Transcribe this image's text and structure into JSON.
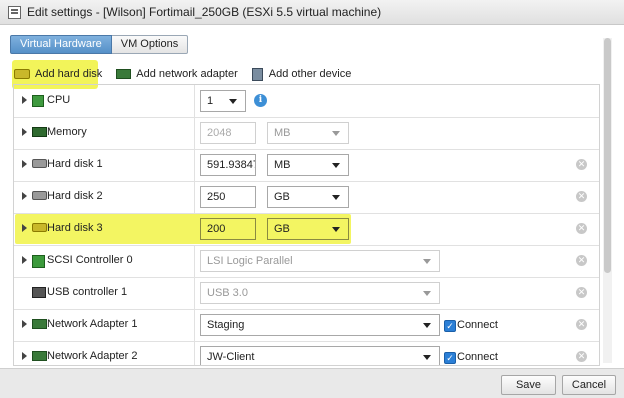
{
  "window": {
    "title": "Edit settings - [Wilson] Fortimail_250GB (ESXi 5.5 virtual machine)"
  },
  "tabs": [
    {
      "label": "Virtual Hardware"
    },
    {
      "label": "VM Options"
    }
  ],
  "toolbar": {
    "add_hard_disk": "Add hard disk",
    "add_network_adapter": "Add network adapter",
    "add_other_device": "Add other device"
  },
  "rows": {
    "cpu": {
      "label": "CPU",
      "value": "1"
    },
    "memory": {
      "label": "Memory",
      "value": "2048",
      "unit": "MB"
    },
    "hd1": {
      "label": "Hard disk 1",
      "value": "591.938476",
      "unit": "MB"
    },
    "hd2": {
      "label": "Hard disk 2",
      "value": "250",
      "unit": "GB"
    },
    "hd3": {
      "label": "Hard disk 3",
      "value": "200",
      "unit": "GB"
    },
    "scsi": {
      "label": "SCSI Controller 0",
      "value": "LSI Logic Parallel"
    },
    "usb": {
      "label": "USB controller 1",
      "value": "USB 3.0"
    },
    "net1": {
      "label": "Network Adapter 1",
      "value": "Staging",
      "connect": "Connect"
    },
    "net2": {
      "label": "Network Adapter 2",
      "value": "JW-Client",
      "connect": "Connect"
    }
  },
  "footer": {
    "save": "Save",
    "cancel": "Cancel"
  },
  "colors": {
    "highlight": "#f2f45a",
    "tab_active": "#5590c8",
    "checkbox": "#2b7fd6"
  }
}
